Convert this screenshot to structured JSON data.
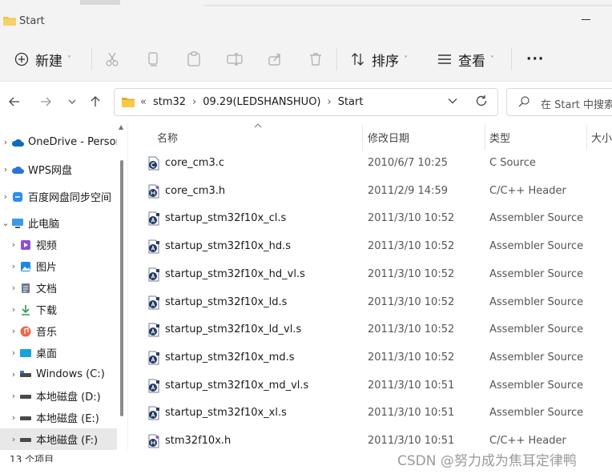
{
  "window": {
    "title": "Start"
  },
  "toolbar": {
    "new_label": "新建",
    "sort_label": "排序",
    "view_label": "查看",
    "more_label": "···"
  },
  "address": {
    "crumbs": [
      "«",
      "stm32",
      "›",
      "09.29(LEDSHANSHUO)",
      "›",
      "Start"
    ],
    "search_placeholder": "在 Start 中搜索"
  },
  "sidebar": {
    "items": [
      {
        "label": "OneDrive - Personal",
        "icon": "cloud-icon",
        "expander": "›"
      },
      {
        "label": "WPS网盘",
        "icon": "wps-cloud-icon",
        "expander": "›"
      },
      {
        "label": "百度网盘同步空间",
        "icon": "baidu-sync-icon",
        "expander": "›"
      },
      {
        "label": "此电脑",
        "icon": "computer-icon",
        "expander": "⌄"
      },
      {
        "label": "视频",
        "icon": "video-icon",
        "expander": "›"
      },
      {
        "label": "图片",
        "icon": "pictures-icon",
        "expander": "›"
      },
      {
        "label": "文档",
        "icon": "documents-icon",
        "expander": "›"
      },
      {
        "label": "下载",
        "icon": "download-icon",
        "expander": "›"
      },
      {
        "label": "音乐",
        "icon": "music-icon",
        "expander": "›"
      },
      {
        "label": "桌面",
        "icon": "desktop-icon",
        "expander": "›"
      },
      {
        "label": "Windows (C:)",
        "icon": "drive-icon",
        "expander": "›"
      },
      {
        "label": "本地磁盘 (D:)",
        "icon": "drive-icon",
        "expander": "›"
      },
      {
        "label": "本地磁盘 (E:)",
        "icon": "drive-icon",
        "expander": "›"
      },
      {
        "label": "本地磁盘 (F:)",
        "icon": "drive-icon",
        "expander": "›"
      }
    ]
  },
  "status": {
    "text": "13 个项目"
  },
  "columns": {
    "name": "名称",
    "date": "修改日期",
    "type": "类型",
    "size": "大小"
  },
  "files": [
    {
      "name": "core_cm3.c",
      "date": "2010/6/7 10:25",
      "type": "C Source",
      "icon": "c-source-file-icon"
    },
    {
      "name": "core_cm3.h",
      "date": "2011/2/9 14:59",
      "type": "C/C++ Header",
      "icon": "header-file-icon"
    },
    {
      "name": "startup_stm32f10x_cl.s",
      "date": "2011/3/10 10:52",
      "type": "Assembler Source",
      "icon": "asm-file-icon"
    },
    {
      "name": "startup_stm32f10x_hd.s",
      "date": "2011/3/10 10:52",
      "type": "Assembler Source",
      "icon": "asm-file-icon"
    },
    {
      "name": "startup_stm32f10x_hd_vl.s",
      "date": "2011/3/10 10:52",
      "type": "Assembler Source",
      "icon": "asm-file-icon"
    },
    {
      "name": "startup_stm32f10x_ld.s",
      "date": "2011/3/10 10:52",
      "type": "Assembler Source",
      "icon": "asm-file-icon"
    },
    {
      "name": "startup_stm32f10x_ld_vl.s",
      "date": "2011/3/10 10:52",
      "type": "Assembler Source",
      "icon": "asm-file-icon"
    },
    {
      "name": "startup_stm32f10x_md.s",
      "date": "2011/3/10 10:52",
      "type": "Assembler Source",
      "icon": "asm-file-icon"
    },
    {
      "name": "startup_stm32f10x_md_vl.s",
      "date": "2011/3/10 10:51",
      "type": "Assembler Source",
      "icon": "asm-file-icon"
    },
    {
      "name": "startup_stm32f10x_xl.s",
      "date": "2011/3/10 10:51",
      "type": "Assembler Source",
      "icon": "asm-file-icon"
    },
    {
      "name": "stm32f10x.h",
      "date": "2011/3/10 10:51",
      "type": "C/C++ Header",
      "icon": "header-file-icon"
    }
  ],
  "watermark": "CSDN @努力成为焦耳定律鸭",
  "colors": {
    "folder": "#f2c14e",
    "accent": "#0067c0",
    "selected_bg": "#e8e8e8"
  }
}
